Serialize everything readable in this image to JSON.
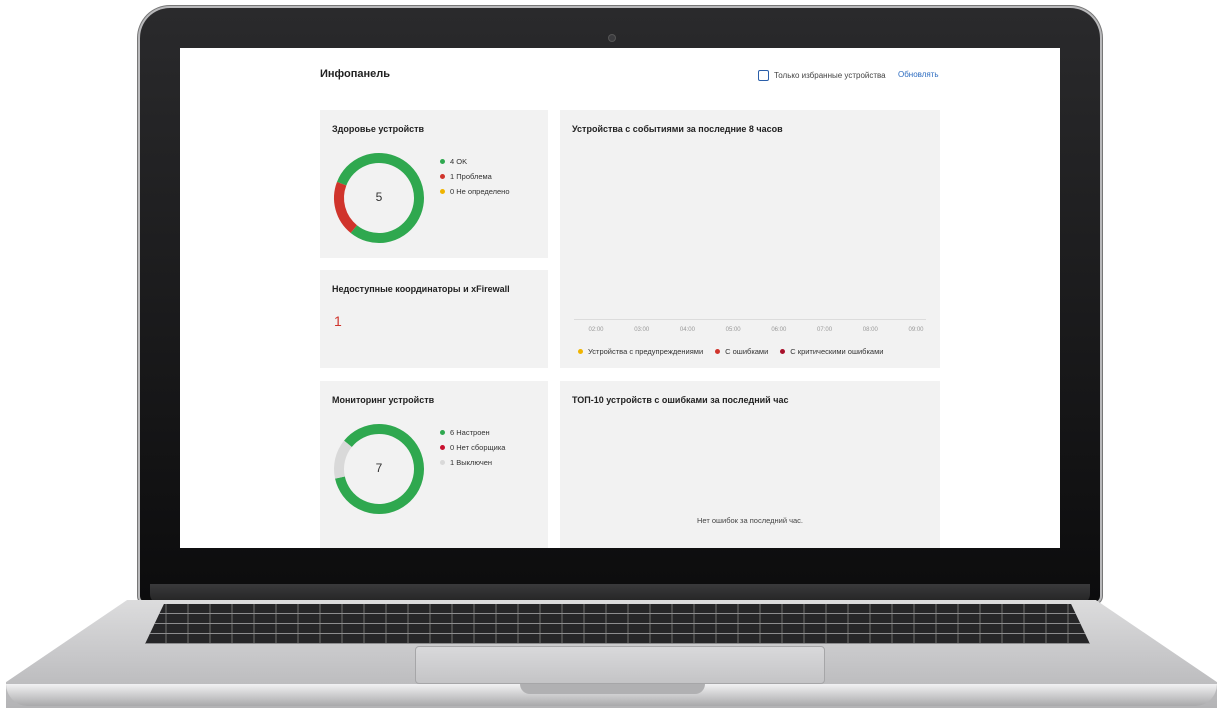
{
  "header": {
    "title": "Инфопанель",
    "favorites_label": "Только избранные устройства",
    "refresh_label": "Обновлять"
  },
  "health": {
    "title": "Здоровье устройств",
    "total": "5",
    "legend": [
      {
        "label": "4 OK",
        "value": 4,
        "color": "#2fa84f"
      },
      {
        "label": "1 Проблема",
        "value": 1,
        "color": "#d0342c"
      },
      {
        "label": "0 Не определено",
        "value": 0,
        "color": "#f0b400"
      }
    ]
  },
  "unavailable": {
    "title": "Недоступные координаторы и xFirewall",
    "value": "1"
  },
  "monitoring": {
    "title": "Мониторинг устройств",
    "total": "7",
    "legend": [
      {
        "label": "6 Настроен",
        "value": 6,
        "color": "#2fa84f"
      },
      {
        "label": "0 Нет сборщика",
        "value": 0,
        "color": "#c8102e"
      },
      {
        "label": "1 Выключен",
        "value": 1,
        "color": "#d9d9d9"
      }
    ]
  },
  "events": {
    "title": "Устройства с событиями за последние 8 часов",
    "times": [
      "02:00",
      "03:00",
      "04:00",
      "05:00",
      "06:00",
      "07:00",
      "08:00",
      "09:00"
    ],
    "legend": [
      {
        "label": "Устройства с предупреждениями",
        "color": "#f0b400"
      },
      {
        "label": "С ошибками",
        "color": "#d0342c"
      },
      {
        "label": "С критическими ошибками",
        "color": "#a8102a"
      }
    ]
  },
  "top10": {
    "title": "ТОП-10 устройств с ошибками за последний час",
    "empty_message": "Нет ошибок за последний час."
  }
}
